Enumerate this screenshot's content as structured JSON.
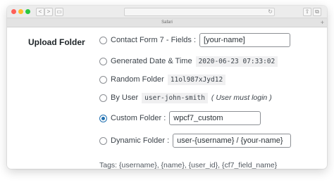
{
  "browser": {
    "tab_title": "Safari",
    "back_glyph": "<",
    "forward_glyph": ">",
    "sidebar_glyph": "▭",
    "reload_glyph": "↻",
    "share_glyph": "⇧",
    "tabs_glyph": "⧉",
    "new_tab_glyph": "+"
  },
  "section": {
    "label": "Upload Folder"
  },
  "options": [
    {
      "label": "Contact Form 7 - Fields :",
      "field": "[your-name]",
      "checked": false
    },
    {
      "label": "Generated Date & Time",
      "code": "2020-06-23 07:33:02",
      "checked": false
    },
    {
      "label": "Random Folder",
      "code": "11ol987xJyd12",
      "checked": false
    },
    {
      "label": "By User",
      "code": "user-john-smith",
      "note": "( User must login )",
      "checked": false
    },
    {
      "label": "Custom Folder :",
      "field": "wpcf7_custom",
      "checked": true
    },
    {
      "label": "Dynamic Folder :",
      "field": "user-{username} / {your-name}",
      "checked": false
    }
  ],
  "tags": "Tags: {username}, {name}, {user_id}, {cf7_field_name}",
  "colors": {
    "accent": "#2271b1",
    "text": "#3c434a",
    "border": "#8c8f94"
  }
}
